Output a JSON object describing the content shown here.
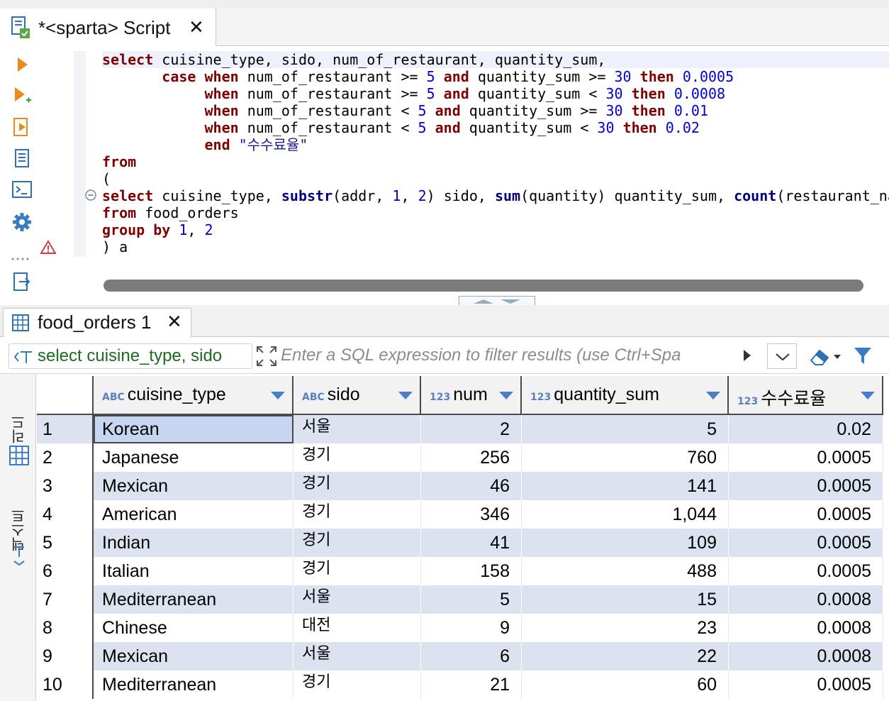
{
  "editor_tab": {
    "title": "*<sparta> Script",
    "close": "✕"
  },
  "code_lines": [
    [
      [
        "kw",
        "select"
      ],
      [
        "t",
        " cuisine_type, sido, num_of_restaurant, quantity_sum,"
      ]
    ],
    [
      [
        "t",
        "       "
      ],
      [
        "kw",
        "case"
      ],
      [
        "t",
        " "
      ],
      [
        "kw",
        "when"
      ],
      [
        "t",
        " num_of_restaurant >= "
      ],
      [
        "num",
        "5"
      ],
      [
        "t",
        " "
      ],
      [
        "kw",
        "and"
      ],
      [
        "t",
        " quantity_sum >= "
      ],
      [
        "num",
        "30"
      ],
      [
        "t",
        " "
      ],
      [
        "kw",
        "then"
      ],
      [
        "t",
        " "
      ],
      [
        "num",
        "0.0005"
      ]
    ],
    [
      [
        "t",
        "            "
      ],
      [
        "kw",
        "when"
      ],
      [
        "t",
        " num_of_restaurant >= "
      ],
      [
        "num",
        "5"
      ],
      [
        "t",
        " "
      ],
      [
        "kw",
        "and"
      ],
      [
        "t",
        " quantity_sum < "
      ],
      [
        "num",
        "30"
      ],
      [
        "t",
        " "
      ],
      [
        "kw",
        "then"
      ],
      [
        "t",
        " "
      ],
      [
        "num",
        "0.0008"
      ]
    ],
    [
      [
        "t",
        "            "
      ],
      [
        "kw",
        "when"
      ],
      [
        "t",
        " num_of_restaurant < "
      ],
      [
        "num",
        "5"
      ],
      [
        "t",
        " "
      ],
      [
        "kw",
        "and"
      ],
      [
        "t",
        " quantity_sum >= "
      ],
      [
        "num",
        "30"
      ],
      [
        "t",
        " "
      ],
      [
        "kw",
        "then"
      ],
      [
        "t",
        " "
      ],
      [
        "num",
        "0.01"
      ]
    ],
    [
      [
        "t",
        "            "
      ],
      [
        "kw",
        "when"
      ],
      [
        "t",
        " num_of_restaurant < "
      ],
      [
        "num",
        "5"
      ],
      [
        "t",
        " "
      ],
      [
        "kw",
        "and"
      ],
      [
        "t",
        " quantity_sum < "
      ],
      [
        "num",
        "30"
      ],
      [
        "t",
        " "
      ],
      [
        "kw",
        "then"
      ],
      [
        "t",
        " "
      ],
      [
        "num",
        "0.02"
      ]
    ],
    [
      [
        "t",
        "            "
      ],
      [
        "kw",
        "end"
      ],
      [
        "t",
        " "
      ],
      [
        "str",
        "\"수수료율\""
      ]
    ],
    [
      [
        "kw",
        "from"
      ]
    ],
    [
      [
        "t",
        "("
      ]
    ],
    [
      [
        "kw",
        "select"
      ],
      [
        "t",
        " cuisine_type, "
      ],
      [
        "fn",
        "substr"
      ],
      [
        "t",
        "(addr, "
      ],
      [
        "num",
        "1"
      ],
      [
        "t",
        ", "
      ],
      [
        "num",
        "2"
      ],
      [
        "t",
        ") sido, "
      ],
      [
        "fn",
        "sum"
      ],
      [
        "t",
        "(quantity) quantity_sum, "
      ],
      [
        "fn",
        "count"
      ],
      [
        "t",
        "(restaurant_na"
      ]
    ],
    [
      [
        "kw",
        "from"
      ],
      [
        "t",
        " food_orders"
      ]
    ],
    [
      [
        "kw",
        "group by"
      ],
      [
        "t",
        " "
      ],
      [
        "num",
        "1"
      ],
      [
        "t",
        ", "
      ],
      [
        "num",
        "2"
      ]
    ],
    [
      [
        "t",
        ") a"
      ]
    ]
  ],
  "results_tab": {
    "title": "food_orders 1",
    "close": "✕"
  },
  "filter": {
    "query_preview": "select cuisine_type, sido",
    "placeholder": "Enter a SQL expression to filter results (use Ctrl+Spa"
  },
  "side_tabs": {
    "grid": "그리드",
    "text": "텍스트"
  },
  "columns": [
    {
      "badge": "ABC",
      "name": "cuisine_type"
    },
    {
      "badge": "ABC",
      "name": "sido"
    },
    {
      "badge": "123",
      "name": "num"
    },
    {
      "badge": "123",
      "name": "quantity_sum"
    },
    {
      "badge": "123",
      "name": "수수료율"
    }
  ],
  "rows": [
    [
      "1",
      "Korean",
      "서울",
      "2",
      "5",
      "0.02"
    ],
    [
      "2",
      "Japanese",
      "경기",
      "256",
      "760",
      "0.0005"
    ],
    [
      "3",
      "Mexican",
      "경기",
      "46",
      "141",
      "0.0005"
    ],
    [
      "4",
      "American",
      "경기",
      "346",
      "1,044",
      "0.0005"
    ],
    [
      "5",
      "Indian",
      "경기",
      "41",
      "109",
      "0.0005"
    ],
    [
      "6",
      "Italian",
      "경기",
      "158",
      "488",
      "0.0005"
    ],
    [
      "7",
      "Mediterranean",
      "서울",
      "5",
      "15",
      "0.0008"
    ],
    [
      "8",
      "Chinese",
      "대전",
      "9",
      "23",
      "0.0008"
    ],
    [
      "9",
      "Mexican",
      "서울",
      "6",
      "22",
      "0.0008"
    ],
    [
      "10",
      "Mediterranean",
      "경기",
      "21",
      "60",
      "0.0005"
    ]
  ],
  "colors": {
    "keyword": "#7f0000",
    "number": "#0000d0",
    "accent": "#4a7ecb",
    "odd_row": "#dce2ef"
  }
}
